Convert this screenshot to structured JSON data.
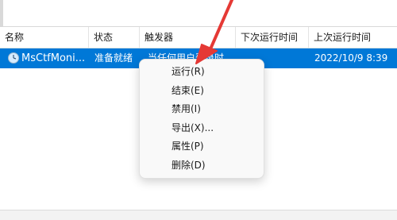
{
  "columns": {
    "name": "名称",
    "status": "状态",
    "trigger": "触发器",
    "next_run": "下次运行时间",
    "last_run": "上次运行时间"
  },
  "task": {
    "name": "MsCtfMoni...",
    "status": "准备就绪",
    "trigger": "当任何用户登录时",
    "last_run": "2022/10/9 8:39"
  },
  "context_menu": [
    {
      "label": "运行(R)"
    },
    {
      "label": "结束(E)"
    },
    {
      "label": "禁用(I)"
    },
    {
      "label": "导出(X)..."
    },
    {
      "label": "属性(P)"
    },
    {
      "label": "删除(D)"
    }
  ],
  "colors": {
    "selection": "#0078d7",
    "annotation_arrow": "#e53935"
  },
  "icons": {
    "task": "clock-icon",
    "annotation": "red-arrow-annotation"
  }
}
